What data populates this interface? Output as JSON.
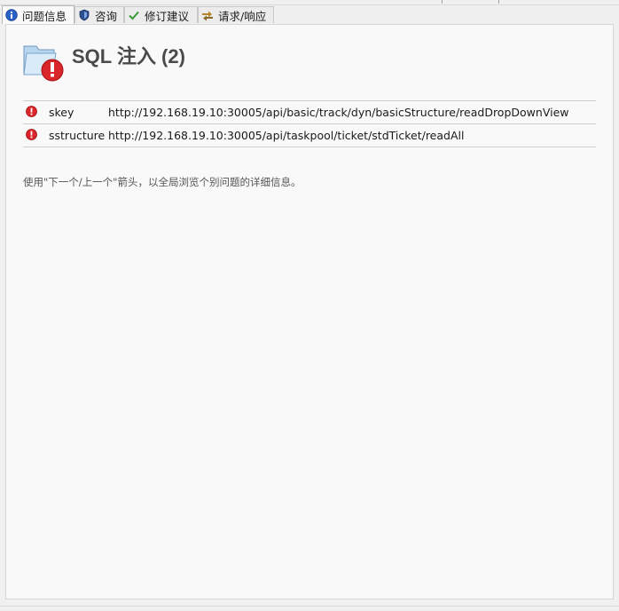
{
  "tabs": [
    {
      "label": "问题信息",
      "icon": "info-icon",
      "active": true
    },
    {
      "label": "咨询",
      "icon": "shield-icon",
      "active": false
    },
    {
      "label": "修订建议",
      "icon": "checkmark-icon",
      "active": false
    },
    {
      "label": "请求/响应",
      "icon": "request-response-icon",
      "active": false
    }
  ],
  "issue": {
    "title": "SQL 注入 (2)",
    "icon": "folder-error-icon"
  },
  "issues_list": [
    {
      "param": "skey",
      "url": "http://192.168.19.10:30005/api/basic/track/dyn/basicStructure/readDropDownView",
      "icon": "error-icon"
    },
    {
      "param": "sstructure",
      "url": "http://192.168.19.10:30005/api/taskpool/ticket/stdTicket/readAll",
      "icon": "error-icon"
    }
  ],
  "hint": "使用\"下一个/上一个\"箭头，以全局浏览个别问题的详细信息。",
  "colors": {
    "error": "#d9262b",
    "title": "#4a4a4a",
    "info": "#2b62c7"
  }
}
